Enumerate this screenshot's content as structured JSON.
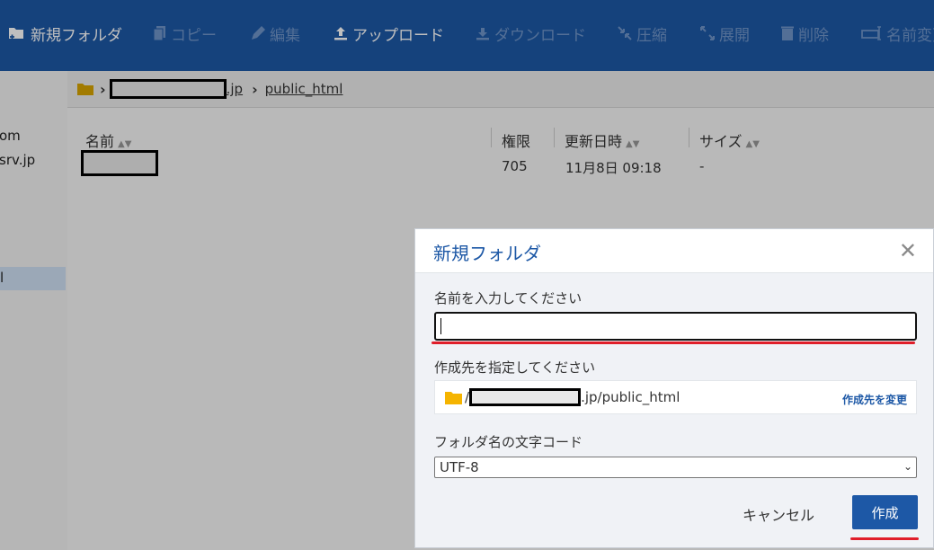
{
  "toolbar": {
    "items": [
      {
        "label": "新規フォルダ",
        "icon": "new-folder-icon",
        "enabled": true
      },
      {
        "label": "コピー",
        "icon": "copy-icon",
        "enabled": false
      },
      {
        "label": "編集",
        "icon": "edit-icon",
        "enabled": false
      },
      {
        "label": "アップロード",
        "icon": "upload-icon",
        "enabled": true
      },
      {
        "label": "ダウンロード",
        "icon": "download-icon",
        "enabled": false
      },
      {
        "label": "圧縮",
        "icon": "compress-icon",
        "enabled": false
      },
      {
        "label": "展開",
        "icon": "extract-icon",
        "enabled": false
      },
      {
        "label": "削除",
        "icon": "trash-icon",
        "enabled": false
      },
      {
        "label": "名前変更",
        "icon": "rename-icon",
        "enabled": false
      }
    ]
  },
  "sidebar": {
    "items": [
      "om",
      "srv.jp",
      "l"
    ]
  },
  "breadcrumb": {
    "domain_suffix": ".jp",
    "current": "public_html"
  },
  "filelist": {
    "columns": [
      "名前",
      "権限",
      "更新日時",
      "サイズ"
    ],
    "rows": [
      {
        "name": "",
        "permission": "705",
        "modified": "11月8日 09:18",
        "size": "-"
      }
    ]
  },
  "dialog": {
    "title": "新規フォルダ",
    "close": "✕",
    "name_label": "名前を入力してください",
    "name_value": "",
    "dest_label": "作成先を指定してください",
    "dest_prefix": "/",
    "dest_suffix": ".jp/public_html",
    "change_link": "作成先を変更",
    "encoding_label": "フォルダ名の文字コード",
    "encoding_value": "UTF-8",
    "cancel": "キャンセル",
    "create": "作成"
  },
  "colors": {
    "brand": "#1d58a6",
    "highlight": "#e01e2a",
    "folder": "#f5b400"
  }
}
